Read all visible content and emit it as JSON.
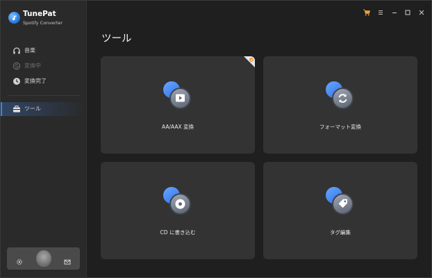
{
  "app": {
    "name": "TunePat",
    "subtitle": "Spotify Converter"
  },
  "sidebar": {
    "items": [
      {
        "label": "音楽",
        "icon": "headphones-icon",
        "state": "normal"
      },
      {
        "label": "変換中",
        "icon": "converting-icon",
        "state": "disabled"
      },
      {
        "label": "変換完了",
        "icon": "clock-icon",
        "state": "normal"
      },
      {
        "label": "ツール",
        "icon": "toolbox-icon",
        "state": "active"
      }
    ],
    "bottom": {
      "settings_icon": "gear-icon",
      "avatar": "avatar",
      "mail_icon": "mail-icon"
    }
  },
  "titlebar": {
    "icons": [
      "cart-icon",
      "menu-icon",
      "minimize-icon",
      "maximize-icon",
      "close-icon"
    ]
  },
  "page": {
    "title": "ツール"
  },
  "tools": [
    {
      "label": "AA/AAX 変換",
      "icon": "play-icon",
      "badge": "corner-badge-icon"
    },
    {
      "label": "フォーマット変換",
      "icon": "refresh-icon"
    },
    {
      "label": "CD に書き込む",
      "icon": "disc-icon"
    },
    {
      "label": "タグ編集",
      "icon": "tag-icon"
    }
  ],
  "colors": {
    "accent": "#3b82f6",
    "background": "#1f1f1f",
    "sidebar": "#2a2a2a",
    "card": "#333333",
    "cart": "#e8a13a"
  }
}
